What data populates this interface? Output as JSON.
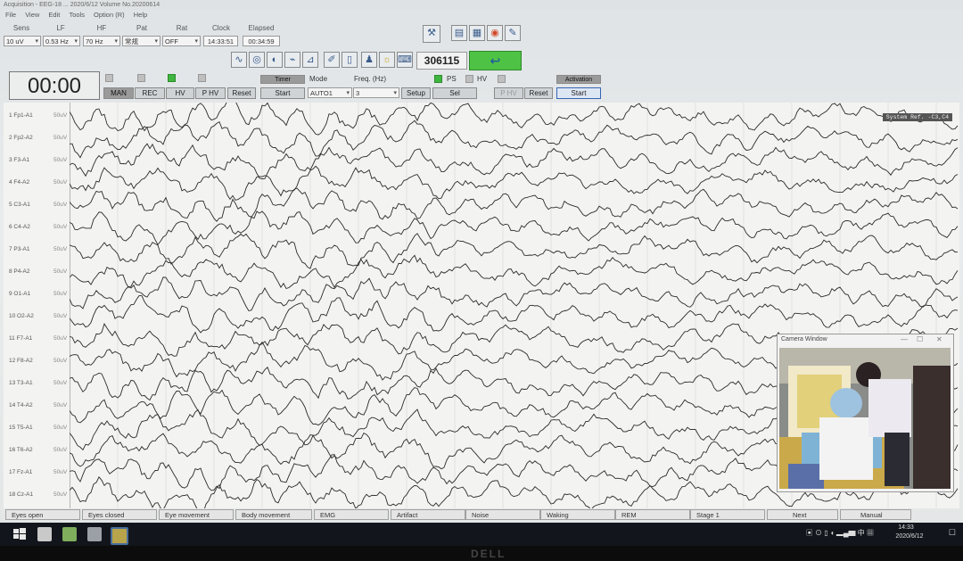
{
  "window": {
    "title": "Acquisition - EEG-18 ... 2020/6/12 Volume No.20200614"
  },
  "menu": [
    "File",
    "View",
    "Edit",
    "Tools",
    "Option (R)",
    "Help"
  ],
  "settings": {
    "headers": [
      "Sens",
      "LF",
      "HF",
      "Pat",
      "Rat",
      "Clock",
      "Elapsed"
    ],
    "sens": "10 uV",
    "lf": "0.53 Hz",
    "hf": "70 Hz",
    "pat": "常规",
    "rat": "OFF",
    "clock": "14:33:51",
    "elapsed": "00:34:59"
  },
  "counter": "306115",
  "timer": "00:00",
  "record_buttons": [
    "MAN",
    "REC",
    "HV",
    "P HV",
    "Reset"
  ],
  "timer_panel": {
    "timer_label": "Timer",
    "start": "Start",
    "mode_label": "Mode",
    "mode_value": "AUTO1",
    "freq_label": "Freq. (Hz)",
    "freq_value": "3",
    "setup": "Setup",
    "sel": "Sel",
    "ps": "PS",
    "hv": "HV",
    "php": "P HV",
    "reset": "Reset",
    "activation": "Activation",
    "act_start": "Start"
  },
  "eeg": {
    "system_label": "System Ref. -C3,C4",
    "unit": "50uV",
    "channels": [
      {
        "num": "1",
        "name": "Fp1-A1"
      },
      {
        "num": "2",
        "name": "Fp2-A2"
      },
      {
        "num": "3",
        "name": "F3-A1"
      },
      {
        "num": "4",
        "name": "F4-A2"
      },
      {
        "num": "5",
        "name": "C3-A1"
      },
      {
        "num": "6",
        "name": "C4-A2"
      },
      {
        "num": "7",
        "name": "P3-A1"
      },
      {
        "num": "8",
        "name": "P4-A2"
      },
      {
        "num": "9",
        "name": "O1-A1"
      },
      {
        "num": "10",
        "name": "O2-A2"
      },
      {
        "num": "11",
        "name": "F7-A1"
      },
      {
        "num": "12",
        "name": "F8-A2"
      },
      {
        "num": "13",
        "name": "T3-A1"
      },
      {
        "num": "14",
        "name": "T4-A2"
      },
      {
        "num": "15",
        "name": "T5-A1"
      },
      {
        "num": "16",
        "name": "T6-A2"
      },
      {
        "num": "17",
        "name": "Fz-A1"
      },
      {
        "num": "18",
        "name": "Cz-A1"
      }
    ]
  },
  "camera": {
    "title": "Camera Window"
  },
  "events": [
    "Eyes open",
    "Eyes closed",
    "Eye movement",
    "Body movement",
    "EMG",
    "Artifact",
    "Noise",
    "Waking",
    "REM",
    "Stage 1",
    "Next",
    "Manual"
  ],
  "taskbar": {
    "time": "14:33",
    "date": "2020/6/12",
    "ime": "中"
  },
  "monitor_brand": "DELL"
}
